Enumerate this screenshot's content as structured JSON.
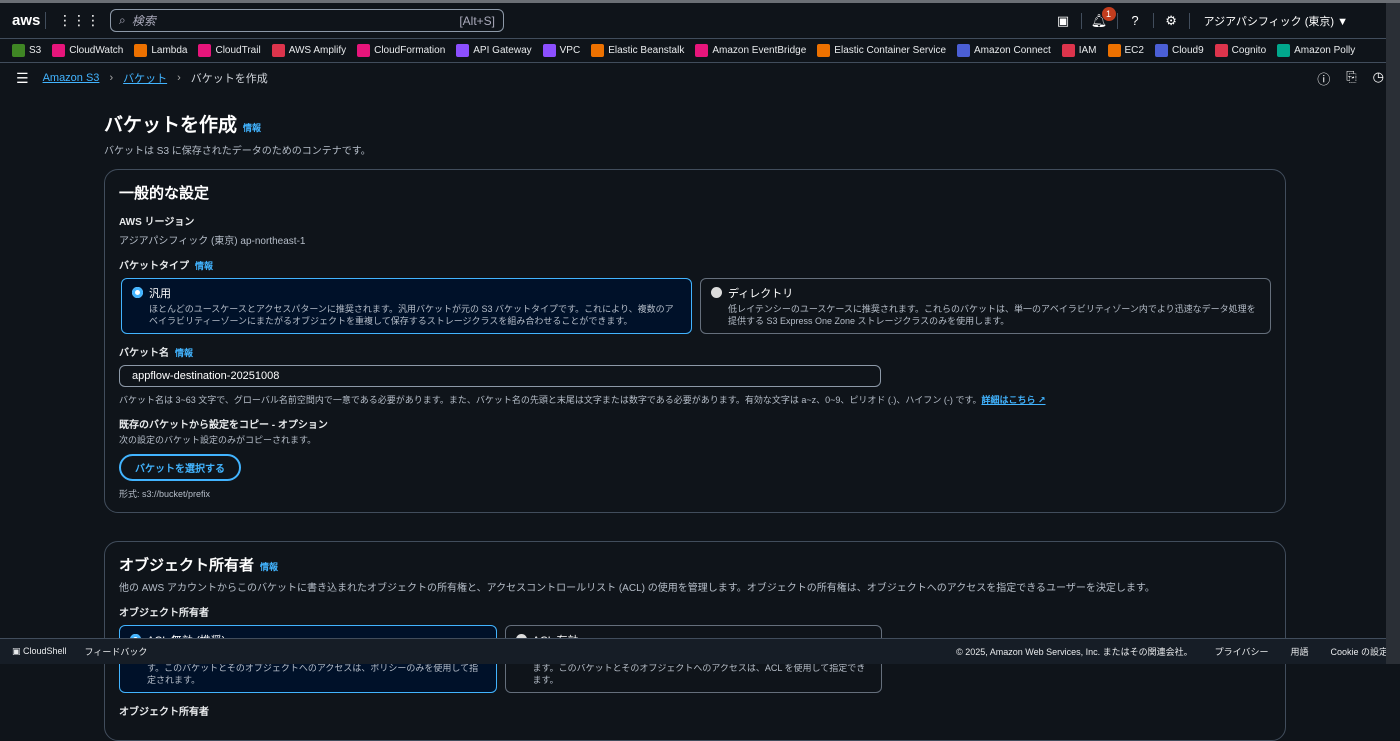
{
  "topnav": {
    "logo": "aws",
    "search_placeholder": "検索",
    "search_shortcut": "[Alt+S]",
    "notifications_count": "1",
    "region": "アジアパシフィック (東京) ▼"
  },
  "favorites": [
    {
      "label": "S3",
      "color": "#3f8624"
    },
    {
      "label": "CloudWatch",
      "color": "#e7157b"
    },
    {
      "label": "Lambda",
      "color": "#ed7100"
    },
    {
      "label": "CloudTrail",
      "color": "#e7157b"
    },
    {
      "label": "AWS Amplify",
      "color": "#dd344c"
    },
    {
      "label": "CloudFormation",
      "color": "#e7157b"
    },
    {
      "label": "API Gateway",
      "color": "#8c4fff"
    },
    {
      "label": "VPC",
      "color": "#8c4fff"
    },
    {
      "label": "Elastic Beanstalk",
      "color": "#ed7100"
    },
    {
      "label": "Amazon EventBridge",
      "color": "#e7157b"
    },
    {
      "label": "Elastic Container Service",
      "color": "#ed7100"
    },
    {
      "label": "Amazon Connect",
      "color": "#4b5fd6"
    },
    {
      "label": "IAM",
      "color": "#dd344c"
    },
    {
      "label": "EC2",
      "color": "#ed7100"
    },
    {
      "label": "Cloud9",
      "color": "#4b5fd6"
    },
    {
      "label": "Cognito",
      "color": "#dd344c"
    },
    {
      "label": "Amazon Polly",
      "color": "#01a88d"
    }
  ],
  "breadcrumb": {
    "items": [
      "Amazon S3",
      "バケット"
    ],
    "current": "バケットを作成"
  },
  "page": {
    "title": "バケットを作成",
    "info": "情報",
    "description": "バケットは S3 に保存されたデータのためのコンテナです。"
  },
  "general": {
    "title": "一般的な設定",
    "region_label": "AWS リージョン",
    "region_value": "アジアパシフィック (東京) ap-northeast-1",
    "type_label": "バケットタイプ",
    "info": "情報",
    "types": [
      {
        "title": "汎用",
        "desc": "ほとんどのユースケースとアクセスパターンに推奨されます。汎用バケットが元の S3 バケットタイプです。これにより、複数のアベイラビリティーゾーンにまたがるオブジェクトを重複して保存するストレージクラスを組み合わせることができます。"
      },
      {
        "title": "ディレクトリ",
        "desc": "低レイテンシーのユースケースに推奨されます。これらのバケットは、単一のアベイラビリティゾーン内でより迅速なデータ処理を提供する S3 Express One Zone ストレージクラスのみを使用します。"
      }
    ],
    "name_label": "バケット名",
    "name_value": "appflow-destination-20251008",
    "name_hint": "バケット名は 3~63 文字で、グローバル名前空間内で一意である必要があります。また、バケット名の先頭と末尾は文字または数字である必要があります。有効な文字は a~z、0~9、ピリオド (.)、ハイフン (-) です。",
    "learn_more": "詳細はこちら ↗",
    "copy_label": "既存のバケットから設定をコピー - オプション",
    "copy_desc": "次の設定のバケット設定のみがコピーされます。",
    "choose_button": "バケットを選択する",
    "format": "形式: s3://bucket/prefix"
  },
  "ownership": {
    "title": "オブジェクト所有者",
    "info": "情報",
    "desc": "他の AWS アカウントからこのバケットに書き込まれたオブジェクトの所有権と、アクセスコントロールリスト (ACL) の使用を管理します。オブジェクトの所有権は、オブジェクトへのアクセスを指定できるユーザーを決定します。",
    "label": "オブジェクト所有者",
    "options": [
      {
        "title": "ACL 無効 (推奨)",
        "desc": "このバケット内のすべてのオブジェクトは、このアカウントによって所有されます。このバケットとそのオブジェクトへのアクセスは、ポリシーのみを使用して指定されます。"
      },
      {
        "title": "ACL 有効",
        "desc": "他の AWS アカウントがこのバケット内のオブジェクトの所有者となることができます。このバケットとそのオブジェクトへのアクセスは、ACL を使用して指定できます。"
      }
    ],
    "next_label": "オブジェクト所有者"
  },
  "footer": {
    "cloudshell": "CloudShell",
    "feedback": "フィードバック",
    "copyright": "© 2025, Amazon Web Services, Inc. またはその関連会社。",
    "privacy": "プライバシー",
    "terms": "用語",
    "cookies": "Cookie の設定"
  }
}
